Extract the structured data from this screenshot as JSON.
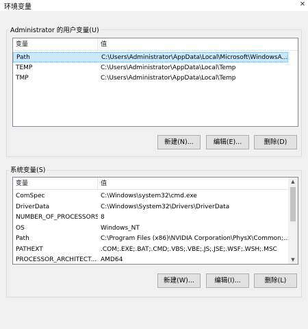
{
  "window": {
    "title": "环境变量",
    "close_glyph": "✕"
  },
  "user_vars": {
    "group_label": "Administrator 的用户变量(U)",
    "columns": [
      "变量",
      "值"
    ],
    "rows": [
      {
        "name": "Path",
        "value": "C:\\Users\\Administrator\\AppData\\Local\\Microsoft\\WindowsA...",
        "selected": true
      },
      {
        "name": "TEMP",
        "value": "C:\\Users\\Administrator\\AppData\\Local\\Temp",
        "selected": false
      },
      {
        "name": "TMP",
        "value": "C:\\Users\\Administrator\\AppData\\Local\\Temp",
        "selected": false
      }
    ],
    "buttons": {
      "new": "新建(N)...",
      "edit": "编辑(E)...",
      "delete": "删除(D)"
    }
  },
  "system_vars": {
    "group_label": "系统变量(S)",
    "columns": [
      "变量",
      "值"
    ],
    "rows": [
      {
        "name": "ComSpec",
        "value": "C:\\Windows\\system32\\cmd.exe"
      },
      {
        "name": "DriverData",
        "value": "C:\\Windows\\System32\\Drivers\\DriverData"
      },
      {
        "name": "NUMBER_OF_PROCESSORS",
        "value": "8"
      },
      {
        "name": "OS",
        "value": "Windows_NT"
      },
      {
        "name": "Path",
        "value": "C:\\Program Files (x86)\\NVIDIA Corporation\\PhysX\\Common;..."
      },
      {
        "name": "PATHEXT",
        "value": ".COM;.EXE;.BAT;.CMD;.VBS;.VBE;.JS;.JSE;.WSF;.WSH;.MSC"
      },
      {
        "name": "PROCESSOR_ARCHITECT...",
        "value": "AMD64"
      }
    ],
    "buttons": {
      "new": "新建(W)...",
      "edit": "编辑(I)...",
      "delete": "删除(L)"
    },
    "scroll_position": 0.0
  },
  "colors": {
    "selection": "#cce8ff",
    "background": "#f0f0f0"
  }
}
